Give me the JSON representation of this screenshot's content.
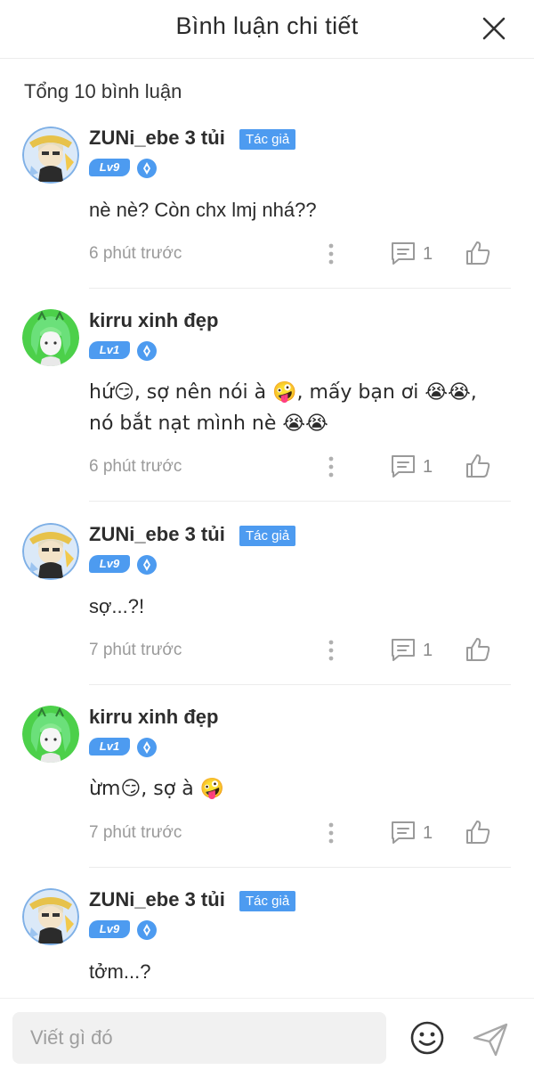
{
  "header": {
    "title": "Bình luận chi tiết"
  },
  "total_label": "Tổng 10 bình luận",
  "author_badge": "Tác giả",
  "comments": [
    {
      "name": "ZUNi_ebe 3 tủi",
      "level": "Lv9",
      "is_author": true,
      "avatar": "writer-avatar",
      "text": "nè nè? Còn chx lmj nhá??",
      "time": "6 phút trước",
      "replies": "1"
    },
    {
      "name": "kirru xinh đẹp",
      "level": "Lv1",
      "is_author": false,
      "avatar": "green-hair-avatar",
      "text": "hứ😏, sợ nên nói à 🤪, mấy bạn ơi 😭😭, nó bắt nạt mình nè 😭😭",
      "time": "6 phút trước",
      "replies": "1"
    },
    {
      "name": "ZUNi_ebe 3 tủi",
      "level": "Lv9",
      "is_author": true,
      "avatar": "writer-avatar",
      "text": "sợ...?!",
      "time": "7 phút trước",
      "replies": "1"
    },
    {
      "name": "kirru xinh đẹp",
      "level": "Lv1",
      "is_author": false,
      "avatar": "green-hair-avatar",
      "text": "ừm😏, sợ à 🤪",
      "time": "7 phút trước",
      "replies": "1"
    },
    {
      "name": "ZUNi_ebe 3 tủi",
      "level": "Lv9",
      "is_author": true,
      "avatar": "writer-avatar",
      "text": "tởm...?",
      "time": "",
      "replies": ""
    }
  ],
  "composer": {
    "placeholder": "Viết gì đó"
  },
  "icons": {
    "close": "close-icon",
    "more": "more-vertical-icon",
    "reply": "comment-icon",
    "like": "thumbs-up-icon",
    "emoji": "smiley-icon",
    "send": "send-icon",
    "level_gem": "gem-icon"
  },
  "colors": {
    "accent": "#4d9bf0",
    "muted": "#9a9a9a"
  }
}
